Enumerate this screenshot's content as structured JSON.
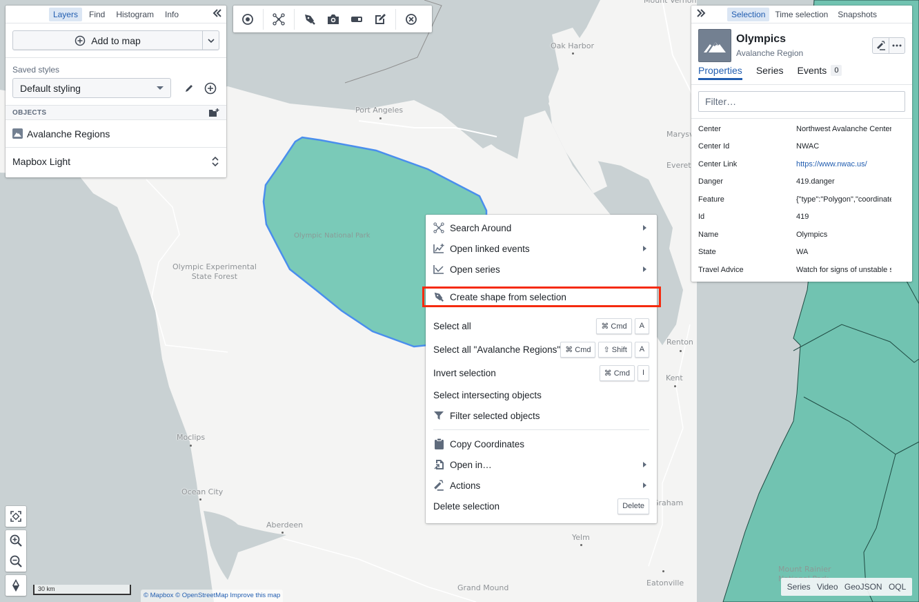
{
  "colors": {
    "accent": "#215db0",
    "highlight_box": "#f52a0e",
    "region_fill": "#5bbfa9",
    "selected_outline": "#4a8eed",
    "water": "#c9d1d3",
    "land": "#f4f4f3"
  },
  "left_panel": {
    "tabs": [
      {
        "label": "Layers",
        "active": true
      },
      {
        "label": "Find",
        "active": false
      },
      {
        "label": "Histogram",
        "active": false
      },
      {
        "label": "Info",
        "active": false
      }
    ],
    "collapse_icon": "double-chevron-left-icon",
    "add_to_map_label": "Add to map",
    "saved_styles_label": "Saved styles",
    "saved_style_value": "Default styling",
    "objects_section_title": "OBJECTS",
    "object_layers": [
      {
        "label": "Avalanche Regions",
        "icon": "mountain-icon"
      }
    ],
    "basemap_label": "Mapbox Light"
  },
  "toolbar": {
    "tools": [
      {
        "name": "select-point-tool",
        "icon": "target-icon"
      },
      {
        "name": "search-around-tool",
        "icon": "graph-icon"
      },
      {
        "name": "draw-shape-tool",
        "icon": "pen-tool-icon"
      },
      {
        "name": "screenshot-tool",
        "icon": "camera-icon"
      },
      {
        "name": "measure-tool",
        "icon": "ruler-icon"
      },
      {
        "name": "annotate-tool",
        "icon": "edit-icon"
      },
      {
        "name": "clear-tool",
        "icon": "cross-circle-icon"
      }
    ]
  },
  "right_panel": {
    "tabs": [
      {
        "label": "Selection",
        "active": true
      },
      {
        "label": "Time selection",
        "active": false
      },
      {
        "label": "Snapshots",
        "active": false
      }
    ],
    "object": {
      "name": "Olympics",
      "type": "Avalanche Region"
    },
    "sub_tabs": [
      {
        "label": "Properties",
        "active": true
      },
      {
        "label": "Series",
        "active": false
      },
      {
        "label": "Events",
        "active": false,
        "count": "0"
      }
    ],
    "filter_placeholder": "Filter…",
    "properties": [
      {
        "key": "Center",
        "value": "Northwest Avalanche Center"
      },
      {
        "key": "Center Id",
        "value": "NWAC"
      },
      {
        "key": "Center Link",
        "value": "https://www.nwac.us/",
        "link": true
      },
      {
        "key": "Danger",
        "value": "419.danger"
      },
      {
        "key": "Feature",
        "value": "{\"type\":\"Polygon\",\"coordinates\""
      },
      {
        "key": "Id",
        "value": "419"
      },
      {
        "key": "Name",
        "value": "Olympics"
      },
      {
        "key": "State",
        "value": "WA"
      },
      {
        "key": "Travel Advice",
        "value": "Watch for signs of unstable snow"
      }
    ]
  },
  "context_menu": {
    "items": [
      {
        "label": "Search Around",
        "icon": "graph-icon",
        "submenu": true
      },
      {
        "label": "Open linked events",
        "icon": "timeline-events-icon",
        "submenu": true
      },
      {
        "label": "Open series",
        "icon": "line-chart-icon",
        "submenu": true
      },
      {
        "divider": true
      },
      {
        "label": "Create shape from selection",
        "icon": "pen-tool-icon",
        "highlighted": true
      },
      {
        "divider": true
      },
      {
        "label": "Select all",
        "shortcut": [
          "⌘ Cmd",
          "A"
        ]
      },
      {
        "label": "Select all \"Avalanche Regions\"",
        "shortcut": [
          "⌘ Cmd",
          "⇧ Shift",
          "A"
        ]
      },
      {
        "label": "Invert selection",
        "shortcut": [
          "⌘ Cmd",
          "I"
        ]
      },
      {
        "label": "Select intersecting objects"
      },
      {
        "label": "Filter selected objects",
        "icon": "filter-icon"
      },
      {
        "divider": true
      },
      {
        "label": "Copy Coordinates",
        "icon": "clipboard-icon"
      },
      {
        "label": "Open in…",
        "icon": "document-open-icon",
        "submenu": true
      },
      {
        "label": "Actions",
        "icon": "actions-icon",
        "submenu": true
      },
      {
        "label": "Delete selection",
        "shortcut": [
          "Delete"
        ]
      }
    ]
  },
  "map": {
    "labels": [
      {
        "text": "Mount Vernon",
        "dot": true
      },
      {
        "text": "Oak Harbor",
        "dot": true
      },
      {
        "text": "Port Angeles",
        "dot": true
      },
      {
        "text": "Everett",
        "dot": true
      },
      {
        "text": "Marysville",
        "dot": true
      },
      {
        "text": "Olympic National Park",
        "dot": false
      },
      {
        "text": "Olympic Experimental\nState Forest",
        "dot": false
      },
      {
        "text": "Renton",
        "dot": true
      },
      {
        "text": "Kent",
        "dot": true
      },
      {
        "text": "Moclips",
        "dot": true
      },
      {
        "text": "Ocean City",
        "dot": true
      },
      {
        "text": "Aberdeen",
        "dot": true
      },
      {
        "text": "Yelm",
        "dot": true
      },
      {
        "text": "Grand Mound",
        "dot": true
      },
      {
        "text": "Eatonville",
        "dot": true
      },
      {
        "text": "Graham",
        "dot": true
      },
      {
        "text": "Mount Rainier\nNational Park",
        "dot": false
      }
    ],
    "scale_label": "30 km",
    "attribution": "© Mapbox © OpenStreetMap Improve this map",
    "controls": [
      {
        "name": "fit-bounds",
        "icon": "fit-bounds-icon"
      },
      {
        "name": "zoom-in",
        "icon": "zoom-in-icon"
      },
      {
        "name": "zoom-out",
        "icon": "zoom-out-icon"
      },
      {
        "name": "compass",
        "icon": "compass-icon"
      }
    ],
    "export_links": [
      "Series",
      "Video",
      "GeoJSON",
      "OQL"
    ]
  }
}
